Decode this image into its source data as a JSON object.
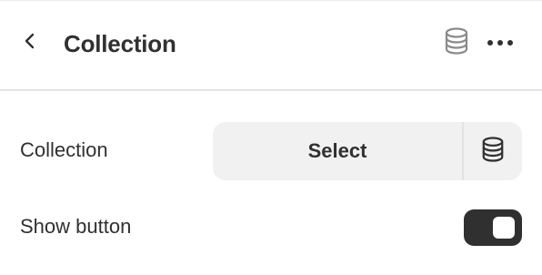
{
  "header": {
    "title": "Collection",
    "back_icon": "chevron-left-icon",
    "source_icon": "database-icon",
    "more_icon": "ellipsis-horizontal-icon"
  },
  "settings": {
    "collection": {
      "label": "Collection",
      "button_label": "Select",
      "dynamic_source_icon": "database-icon"
    },
    "show_button": {
      "label": "Show button",
      "enabled": true
    }
  },
  "colors": {
    "text": "#303030",
    "toggle_on": "#303030",
    "select_bg": "#f1f1f1",
    "divider": "#e6e6e6"
  }
}
